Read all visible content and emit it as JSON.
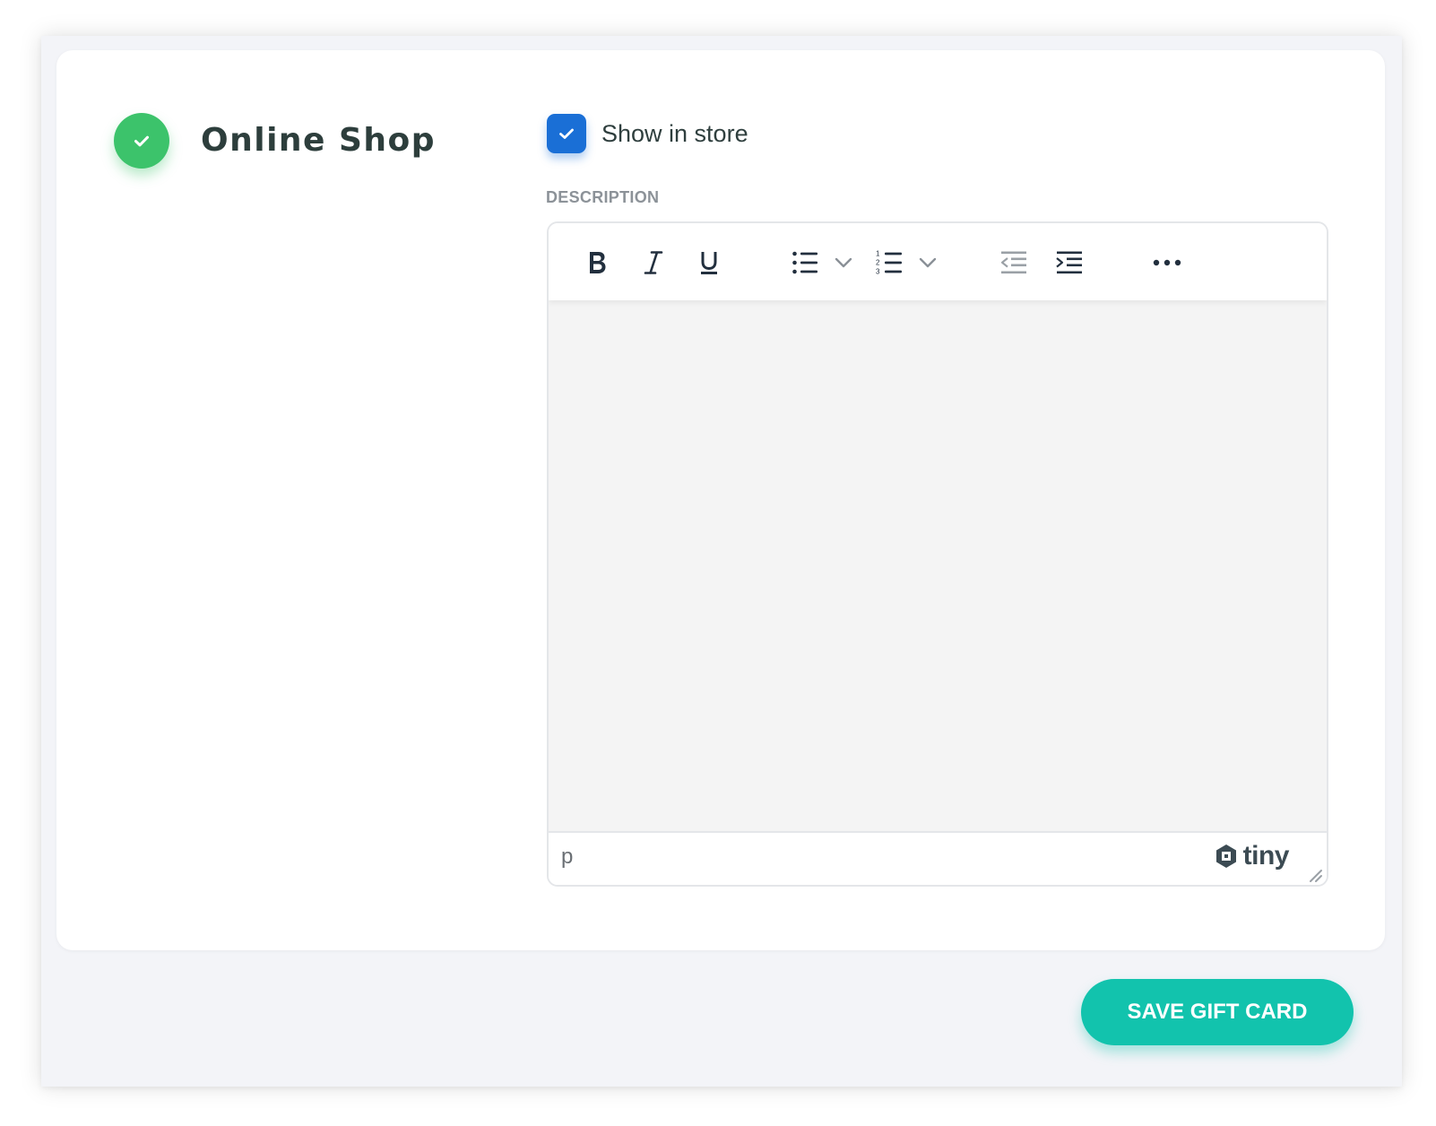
{
  "section": {
    "title": "Online Shop",
    "status_color": "#3cc36b"
  },
  "show_in_store": {
    "label": "Show in store",
    "checked": true,
    "color": "#1a6fd6"
  },
  "description": {
    "label": "DESCRIPTION",
    "toolbar": [
      {
        "name": "bold",
        "icon": "bold-icon"
      },
      {
        "name": "italic",
        "icon": "italic-icon"
      },
      {
        "name": "underline",
        "icon": "underline-icon"
      },
      {
        "name": "bullet-list",
        "icon": "bullet-list-icon"
      },
      {
        "name": "bullet-list-menu",
        "icon": "chevron-down-icon"
      },
      {
        "name": "numbered-list",
        "icon": "numbered-list-icon"
      },
      {
        "name": "numbered-list-menu",
        "icon": "chevron-down-icon"
      },
      {
        "name": "outdent",
        "icon": "outdent-icon"
      },
      {
        "name": "indent",
        "icon": "indent-icon"
      },
      {
        "name": "more",
        "icon": "more-icon"
      }
    ],
    "content": "",
    "element_path": "p",
    "branding": "tiny"
  },
  "actions": {
    "save_label": "SAVE GIFT CARD",
    "save_color": "#12c3ad"
  }
}
